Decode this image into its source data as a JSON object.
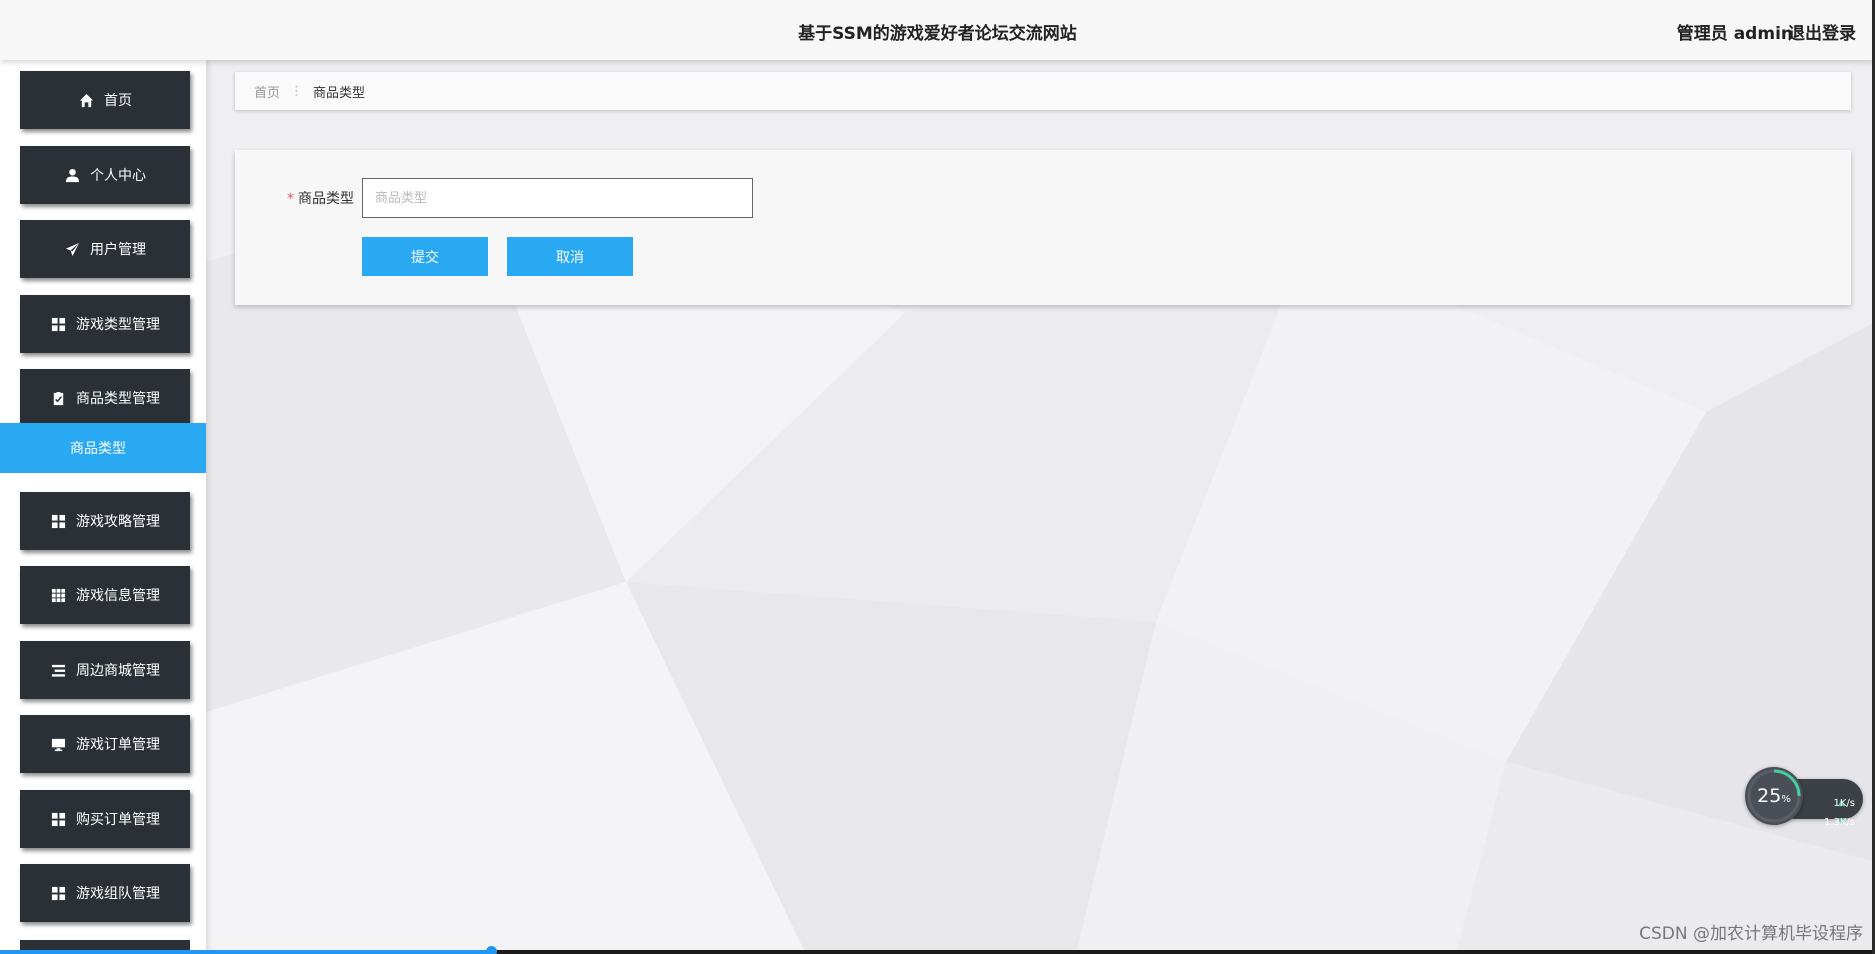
{
  "header": {
    "title": "基于SSM的游戏爱好者论坛交流网站",
    "user": "管理员 admin",
    "logout": "退出登录"
  },
  "sidebar": {
    "items": [
      {
        "label": "首页",
        "icon": "home-icon"
      },
      {
        "label": "个人中心",
        "icon": "user-icon"
      },
      {
        "label": "用户管理",
        "icon": "send-icon"
      },
      {
        "label": "游戏类型管理",
        "icon": "grid-icon"
      },
      {
        "label": "商品类型管理",
        "icon": "clipboard-icon"
      },
      {
        "label": "游戏攻略管理",
        "icon": "grid-icon"
      },
      {
        "label": "游戏信息管理",
        "icon": "table-icon"
      },
      {
        "label": "周边商城管理",
        "icon": "list-icon"
      },
      {
        "label": "游戏订单管理",
        "icon": "monitor-icon"
      },
      {
        "label": "购买订单管理",
        "icon": "grid-icon"
      },
      {
        "label": "游戏组队管理",
        "icon": "grid-icon"
      }
    ],
    "active_sub": "商品类型"
  },
  "breadcrumb": {
    "home": "首页",
    "separator": "⋮",
    "current": "商品类型"
  },
  "form": {
    "field_label": "商品类型",
    "required_mark": "*",
    "placeholder": "商品类型",
    "value": "",
    "submit_label": "提交",
    "cancel_label": "取消"
  },
  "network_widget": {
    "percent": "25",
    "percent_unit": "%",
    "upload": "1K/s",
    "download": "1.3K/s"
  },
  "watermark": "CSDN @加农计算机毕设程序",
  "colors": {
    "accent": "#2aa9f3",
    "sidebar_button": "#2b3036",
    "required": "#e95757"
  }
}
